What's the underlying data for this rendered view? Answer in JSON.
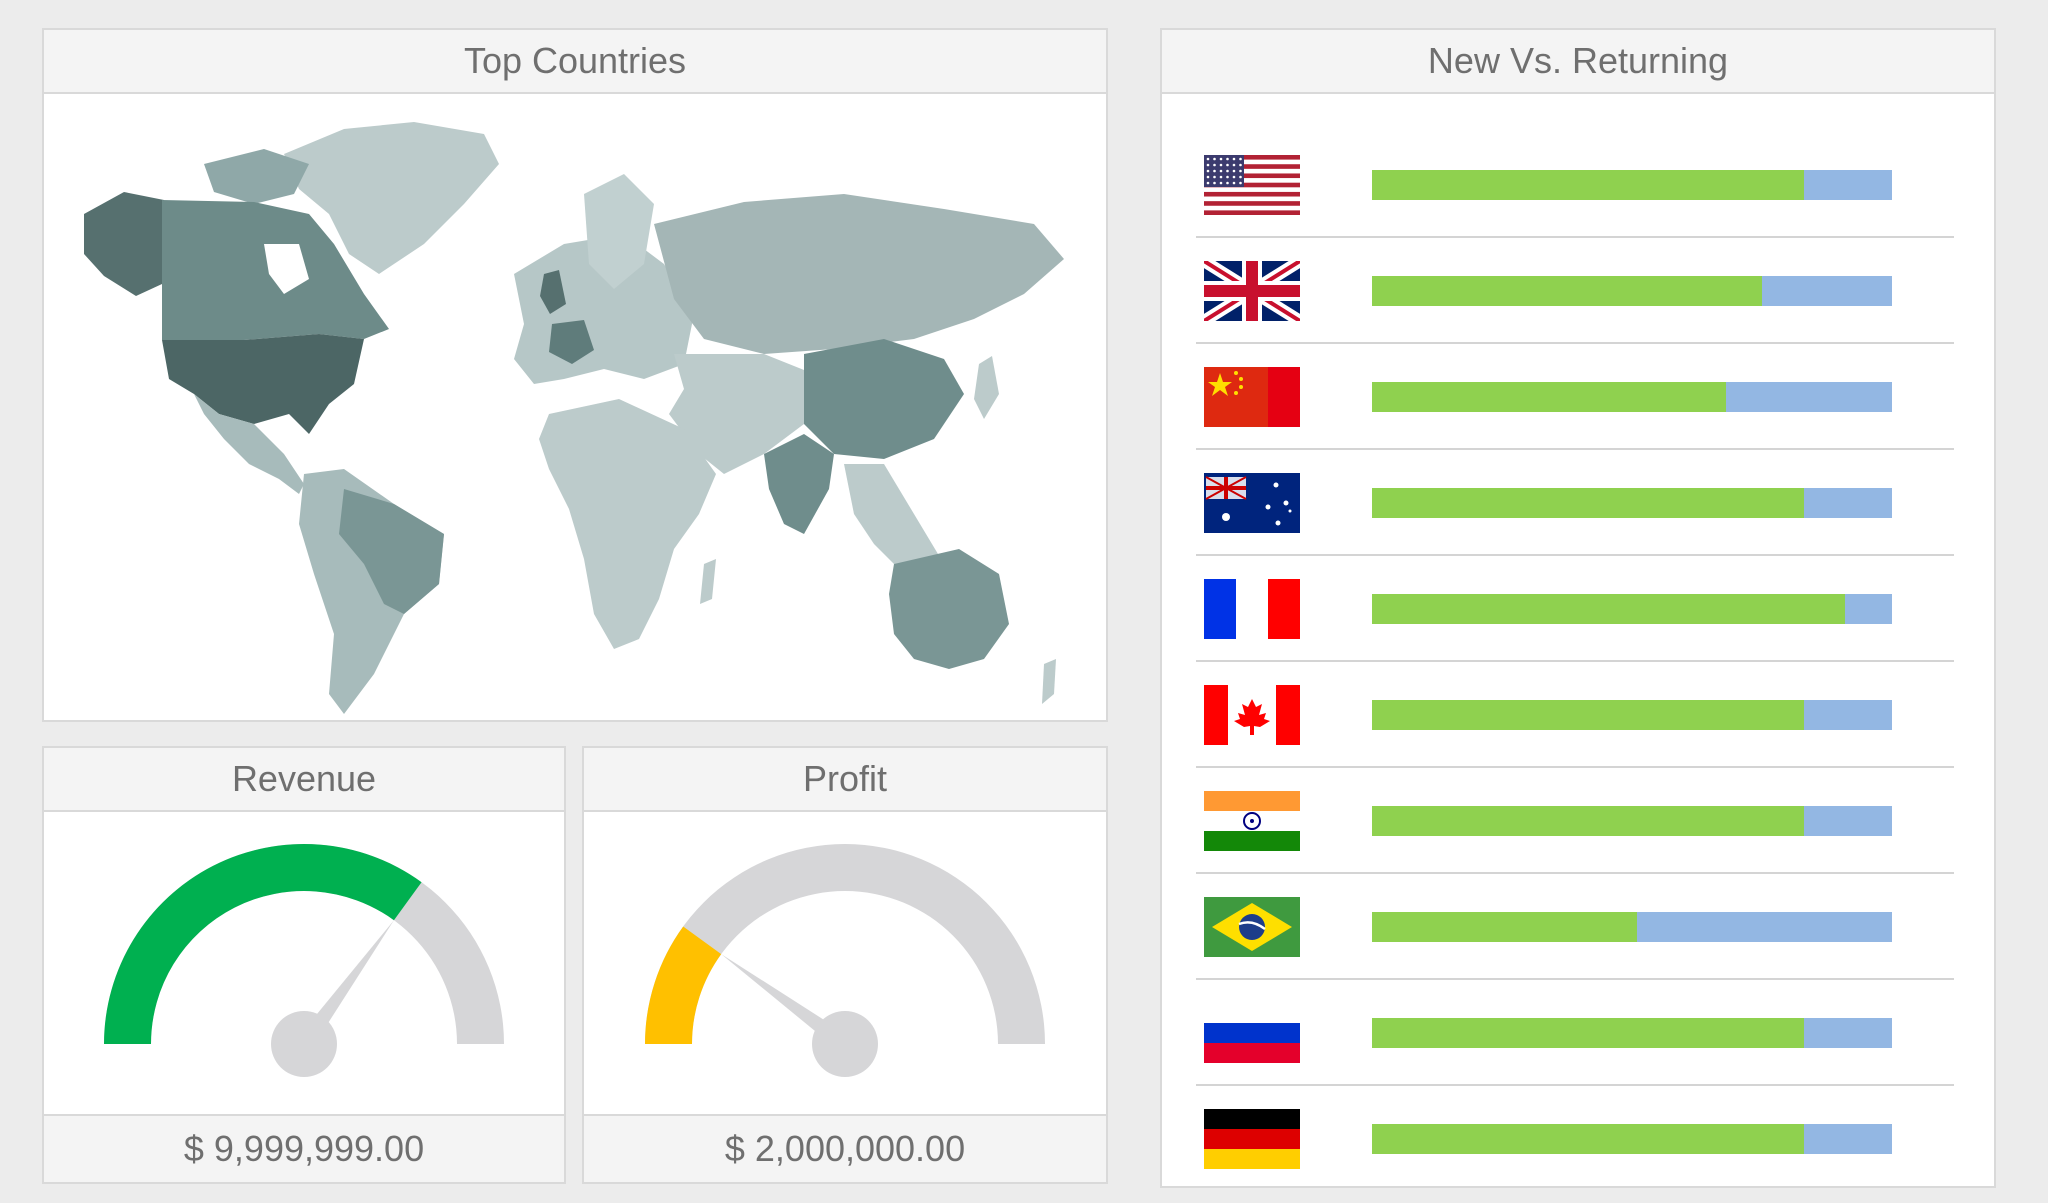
{
  "map_panel": {
    "title": "Top Countries"
  },
  "revenue_panel": {
    "title": "Revenue",
    "value_text": "$ 9,999,999.00",
    "gauge_fraction": 0.7,
    "gauge_color": "#00b050"
  },
  "profit_panel": {
    "title": "Profit",
    "value_text": "$ 2,000,000.00",
    "gauge_fraction": 0.2,
    "gauge_color": "#ffc000"
  },
  "nvr_panel": {
    "title": "New Vs. Returning",
    "colors": {
      "new": "#8fd14f",
      "returning": "#93b7e3"
    },
    "rows": [
      {
        "country": "United States",
        "flag": "us-flag-icon",
        "new_fraction": 0.83
      },
      {
        "country": "United Kingdom",
        "flag": "uk-flag-icon",
        "new_fraction": 0.75
      },
      {
        "country": "China",
        "flag": "china-flag-icon",
        "new_fraction": 0.68
      },
      {
        "country": "Australia",
        "flag": "australia-flag-icon",
        "new_fraction": 0.83
      },
      {
        "country": "France",
        "flag": "france-flag-icon",
        "new_fraction": 0.91
      },
      {
        "country": "Canada",
        "flag": "canada-flag-icon",
        "new_fraction": 0.83
      },
      {
        "country": "India",
        "flag": "india-flag-icon",
        "new_fraction": 0.83
      },
      {
        "country": "Brazil",
        "flag": "brazil-flag-icon",
        "new_fraction": 0.51
      },
      {
        "country": "Russia",
        "flag": "russia-flag-icon",
        "new_fraction": 0.83
      },
      {
        "country": "Germany",
        "flag": "germany-flag-icon",
        "new_fraction": 0.83
      }
    ]
  }
}
